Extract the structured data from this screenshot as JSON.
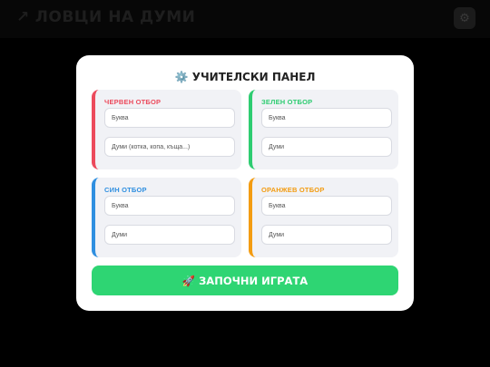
{
  "app": {
    "title": "ЛОВЦИ НА ДУМИ",
    "logo_icon": "↗",
    "settings_icon": "⚙"
  },
  "panel": {
    "icon": "⚙️",
    "title": "УЧИТЕЛСКИ ПАНЕЛ",
    "teams": [
      {
        "name": "ЧЕРВЕН ОТБОР",
        "color": "#ec4a5c",
        "letter_placeholder": "Буква",
        "words_placeholder": "Думи (котка, копа, къща...)"
      },
      {
        "name": "ЗЕЛЕН ОТБОР",
        "color": "#2ecc71",
        "letter_placeholder": "Буква",
        "words_placeholder": "Думи"
      },
      {
        "name": "СИН ОТБОР",
        "color": "#2f8fe0",
        "letter_placeholder": "Буква",
        "words_placeholder": "Думи"
      },
      {
        "name": "ОРАНЖЕВ ОТБОР",
        "color": "#f39c12",
        "letter_placeholder": "Буква",
        "words_placeholder": "Думи"
      }
    ],
    "start_icon": "🚀",
    "start_label": "ЗАПОЧНИ ИГРАТА"
  }
}
